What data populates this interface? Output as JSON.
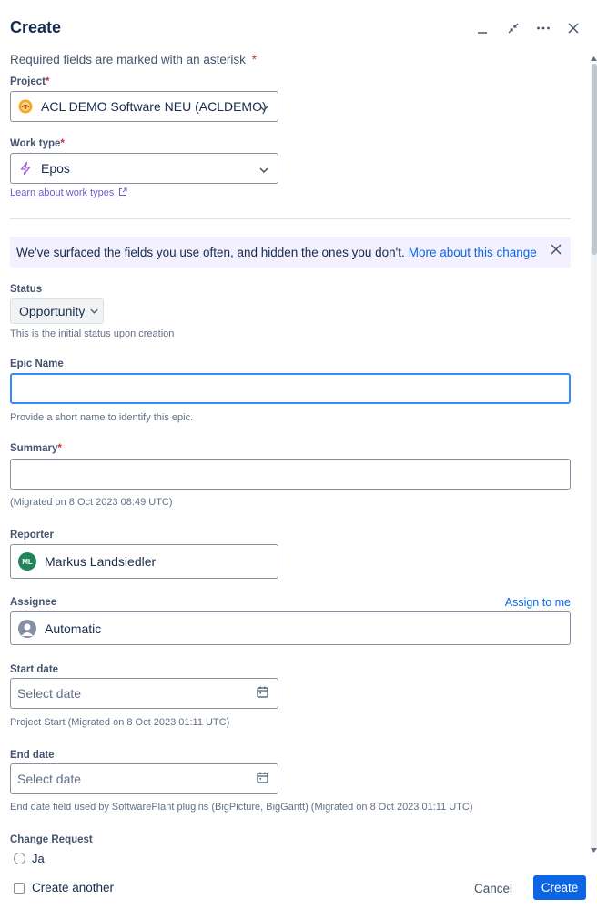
{
  "header": {
    "title": "Create"
  },
  "required_note": "Required fields are marked with an asterisk",
  "asterisk": "*",
  "project": {
    "label": "Project",
    "value": "ACL DEMO Software NEU (ACLDEMO)"
  },
  "work_type": {
    "label": "Work type",
    "value": "Epos",
    "learn_link": "Learn about work types"
  },
  "banner": {
    "text": "We've surfaced the fields you use often, and hidden the ones you don't.",
    "link": "More about this change"
  },
  "status": {
    "label": "Status",
    "value": "Opportunity",
    "help": "This is the initial status upon creation"
  },
  "epic_name": {
    "label": "Epic Name",
    "value": "",
    "help": "Provide a short name to identify this epic."
  },
  "summary": {
    "label": "Summary",
    "value": "",
    "help": "(Migrated on 8 Oct 2023 08:49 UTC)"
  },
  "reporter": {
    "label": "Reporter",
    "initials": "ML",
    "value": "Markus Landsiedler"
  },
  "assignee": {
    "label": "Assignee",
    "assign_link": "Assign to me",
    "value": "Automatic"
  },
  "start_date": {
    "label": "Start date",
    "placeholder": "Select date",
    "help": "Project Start (Migrated on 8 Oct 2023 01:11 UTC)"
  },
  "end_date": {
    "label": "End date",
    "placeholder": "Select date",
    "help": "End date field used by SoftwarePlant plugins (BigPicture, BigGantt) (Migrated on 8 Oct 2023 01:11 UTC)"
  },
  "change_request": {
    "label": "Change Request",
    "option": "Ja"
  },
  "footer": {
    "create_another": "Create another",
    "cancel": "Cancel",
    "create": "Create"
  },
  "colors": {
    "primary": "#0c66e4",
    "required": "#c9372c",
    "banner_bg": "#f3f0ff",
    "reporter_avatar": "#1f845a"
  },
  "icons": [
    "minimize-icon",
    "collapse-icon",
    "more-icon",
    "close-icon",
    "chevron-down-icon",
    "project-icon",
    "epic-icon",
    "external-link-icon",
    "calendar-icon",
    "person-icon"
  ]
}
